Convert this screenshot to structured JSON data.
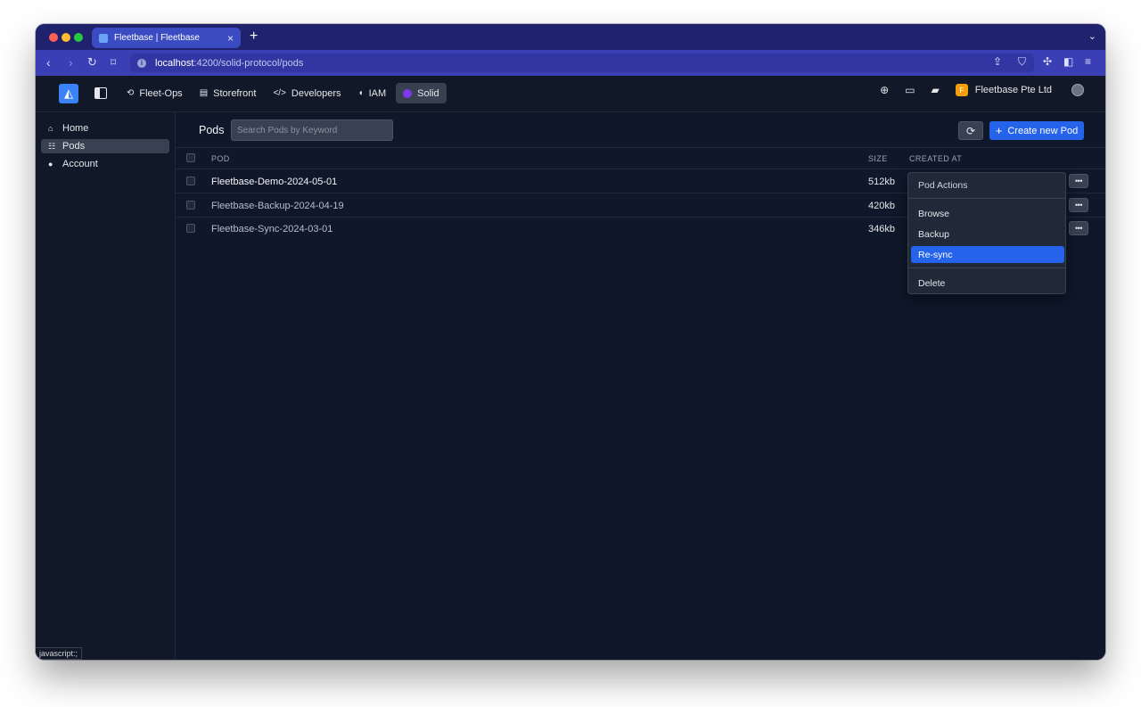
{
  "browser": {
    "tab_title": "Fleetbase | Fleetbase",
    "url_host": "localhost",
    "url_path": ":4200/solid-protocol/pods",
    "status_hint": "javascript:;"
  },
  "header": {
    "nav_items": [
      {
        "label": "Fleet-Ops",
        "icon": "route-icon"
      },
      {
        "label": "Storefront",
        "icon": "store-icon"
      },
      {
        "label": "Developers",
        "icon": "code-icon"
      },
      {
        "label": "IAM",
        "icon": "shield-icon"
      },
      {
        "label": "Solid",
        "icon": "solid-icon",
        "active": true
      }
    ],
    "org_initial": "F",
    "org_name": "Fleetbase Pte Ltd"
  },
  "sidebar": {
    "items": [
      {
        "label": "Home",
        "icon": "home-icon"
      },
      {
        "label": "Pods",
        "icon": "folder-tree-icon",
        "active": true
      },
      {
        "label": "Account",
        "icon": "user-icon"
      }
    ]
  },
  "main": {
    "title": "Pods",
    "search_placeholder": "Search Pods by Keyword",
    "create_label": "Create new Pod",
    "columns": {
      "pod": "POD",
      "size": "SIZE",
      "created_at": "CREATED AT"
    },
    "rows": [
      {
        "name": "Fleetbase-Demo-2024-05-01",
        "size": "512kb"
      },
      {
        "name": "Fleetbase-Backup-2024-04-19",
        "size": "420kb"
      },
      {
        "name": "Fleetbase-Sync-2024-03-01",
        "size": "346kb"
      }
    ]
  },
  "dropdown": {
    "header": "Pod Actions",
    "items": [
      {
        "label": "Browse"
      },
      {
        "label": "Backup"
      },
      {
        "label": "Re-sync",
        "active": true
      },
      {
        "label": "Delete"
      }
    ]
  },
  "colors": {
    "accent": "#2563eb",
    "background": "#0f172a",
    "tabstrip": "#21226e",
    "addressbar": "#3a3fb6"
  }
}
